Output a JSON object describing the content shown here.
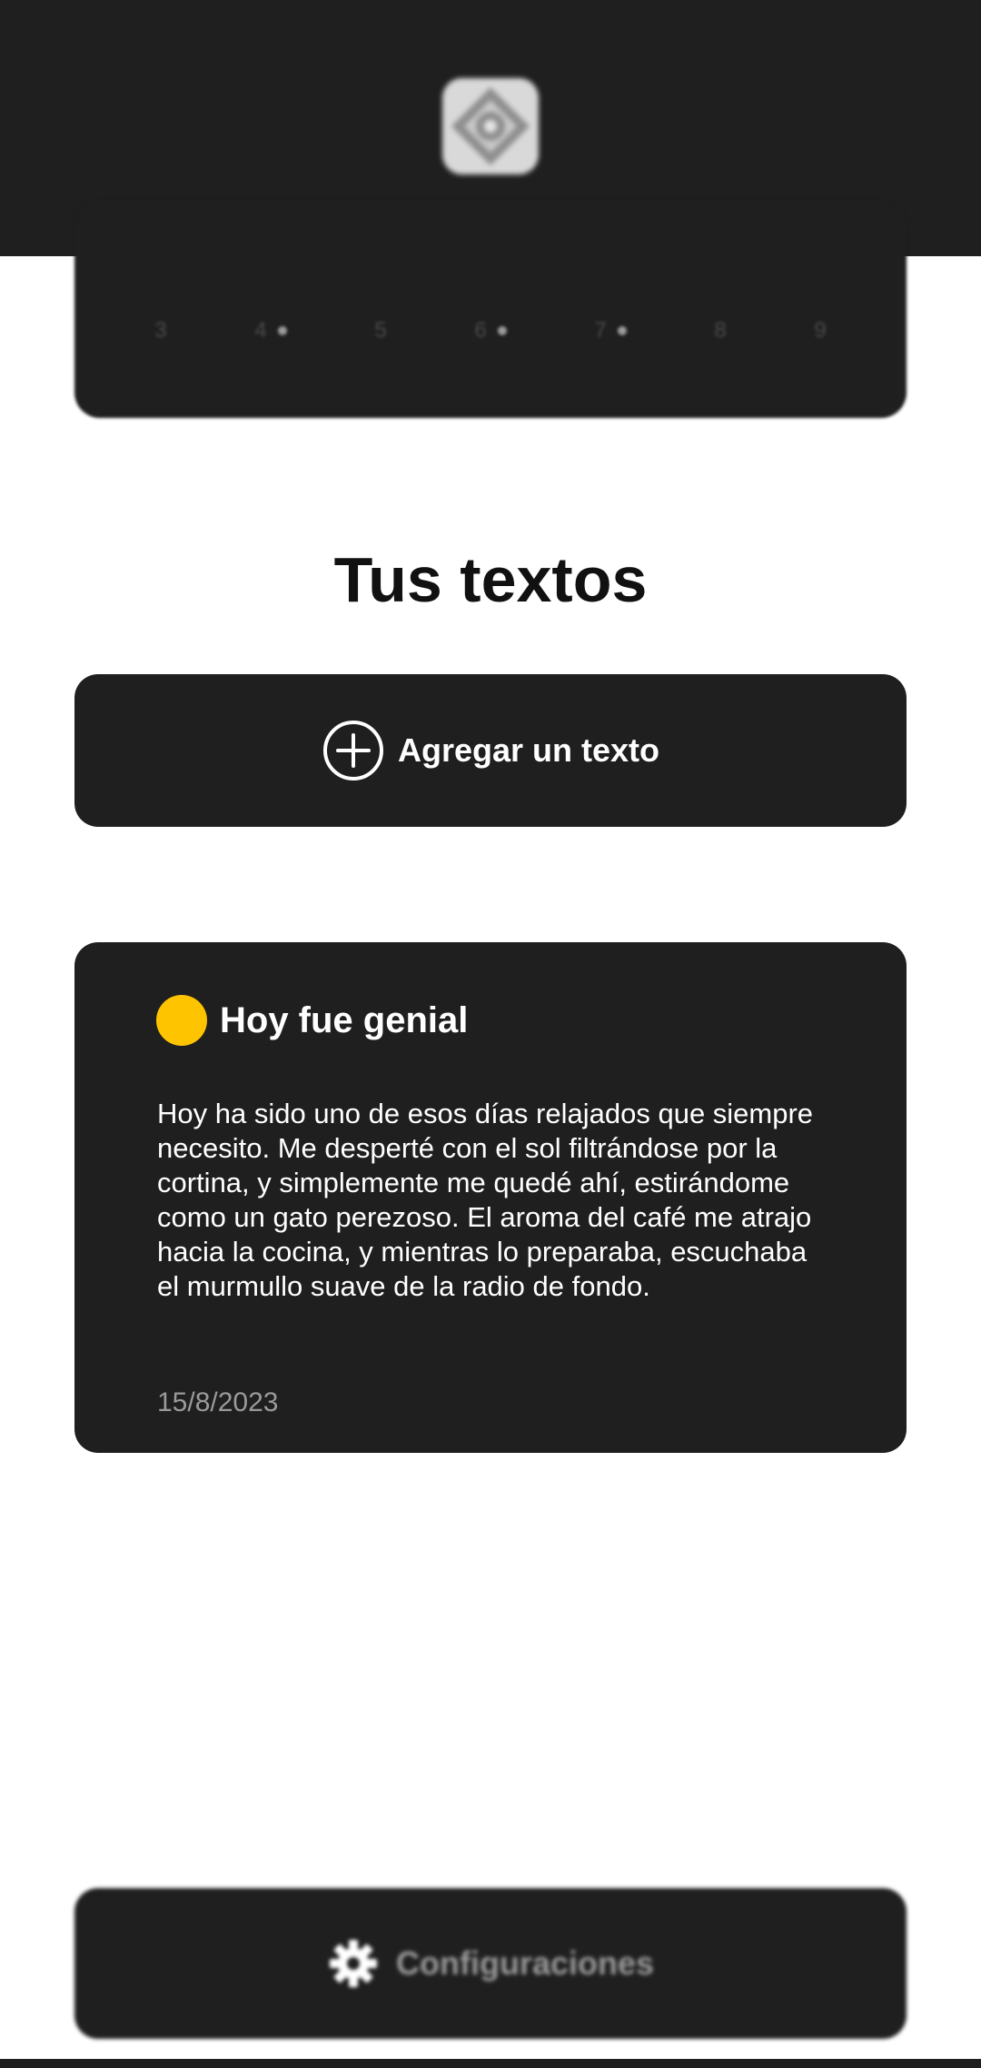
{
  "header": {
    "logo_icon": "app-logo-icon"
  },
  "calendar": {
    "days": [
      {
        "label": "3",
        "marked": false
      },
      {
        "label": "4",
        "marked": true
      },
      {
        "label": "5",
        "marked": false
      },
      {
        "label": "6",
        "marked": true
      },
      {
        "label": "7",
        "marked": true
      },
      {
        "label": "8",
        "marked": false
      },
      {
        "label": "9",
        "marked": false
      }
    ]
  },
  "main": {
    "title": "Tus textos",
    "add_button_label": "Agregar un texto",
    "add_icon": "plus-circle-icon"
  },
  "entries": [
    {
      "title": "Hoy fue genial",
      "mood_color": "#FFC400",
      "body": "Hoy ha sido uno de esos días relajados que siempre necesito. Me desperté con el sol filtrándose por la cortina, y simplemente me quedé ahí, estirándome como un gato perezoso. El aroma del café me atrajo hacia la cocina, y mientras lo preparaba, escuchaba el murmullo suave de la radio de fondo.",
      "date": "15/8/2023"
    }
  ],
  "footer": {
    "settings_label": "Configuraciones",
    "settings_icon": "gear-icon"
  },
  "colors": {
    "dark": "#1F1F1F",
    "background": "#FFFFFF",
    "accent_yellow": "#FFC400",
    "muted_text": "#9A9A9A"
  }
}
